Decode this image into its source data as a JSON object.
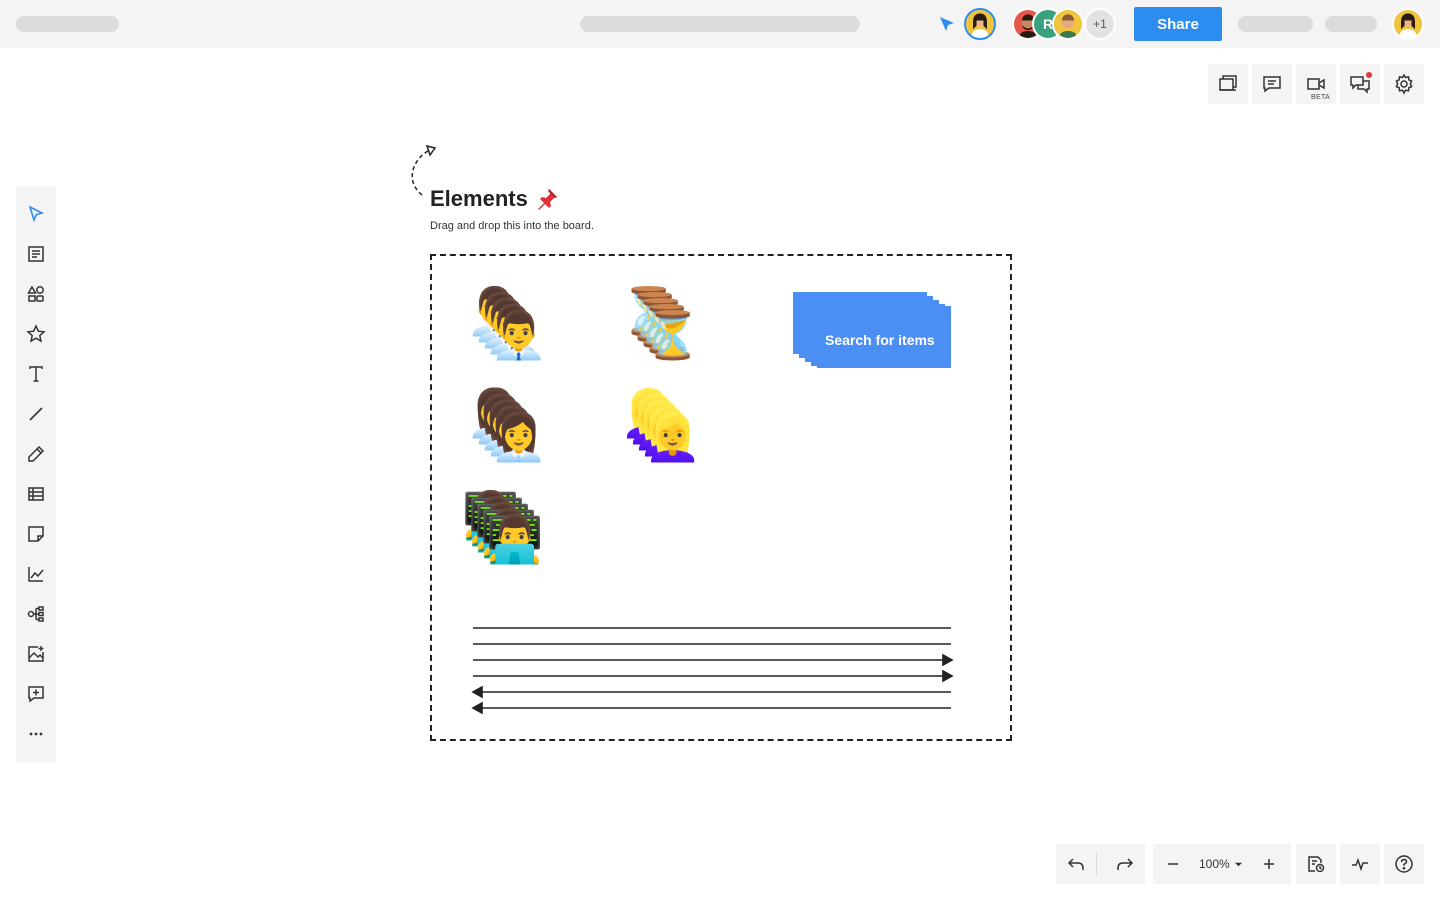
{
  "topbar": {
    "collaborators_more": "+1",
    "collaborator_letter": "R",
    "share_label": "Share"
  },
  "right_tools": {
    "beta_label": "BETA"
  },
  "board": {
    "title": "Elements",
    "subtitle": "Drag and drop this into the board.",
    "search_card_label": "Search for items",
    "emoji": {
      "office_man": "👨‍💼",
      "hourglass": "⏳",
      "office_woman": "👩‍💼",
      "blonde_woman": "👱‍♀️",
      "technologist": "👨‍💻"
    }
  },
  "zoom": {
    "value": "100%"
  },
  "colors": {
    "accent": "#2d8cf0",
    "search_card": "#4b8ff5",
    "toolbar_bg": "#f4f4f4"
  }
}
